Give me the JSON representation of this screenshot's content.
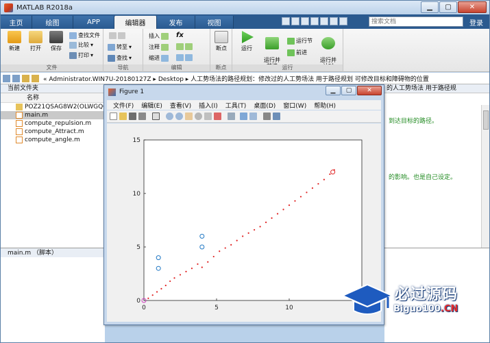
{
  "window": {
    "title": "MATLAB R2018a"
  },
  "tabs": [
    {
      "label": "主页"
    },
    {
      "label": "绘图"
    },
    {
      "label": "APP"
    },
    {
      "label": "编辑器"
    },
    {
      "label": "发布"
    },
    {
      "label": "视图"
    }
  ],
  "search": {
    "placeholder": "搜索文档"
  },
  "login_label": "登录",
  "ribbon": {
    "file_group": {
      "label": "文件",
      "new": "新建",
      "open": "打开",
      "save": "保存",
      "find_files": "查找文件",
      "compare": "比较",
      "print": "打印"
    },
    "nav_group": {
      "label": "导航",
      "goto": "转至",
      "find": "查找"
    },
    "edit_group": {
      "label": "编辑",
      "insert": "插入",
      "comment": "注释",
      "indent": "缩进",
      "fx": "fx"
    },
    "breakpoint_group": {
      "label": "断点",
      "breakpoints": "断点"
    },
    "run_group": {
      "label": "运行",
      "run": "运行",
      "run_advance": "运行并\n前进",
      "run_section": "运行节",
      "advance": "前进",
      "run_time": "运行并\n计时"
    }
  },
  "address": {
    "path": "« Administrator.WIN7U-20180127Z ▸ Desktop ▸ 人工势场法的路径规划：修改过的人工势场法 用于路径规划 可修改目标和障碍物的位置"
  },
  "file_browser": {
    "title": "当前文件夹",
    "column": "名称",
    "files": [
      {
        "name": "POZ21QSAG8W2(OLWGQC",
        "type": "folder"
      },
      {
        "name": "main.m",
        "type": "m",
        "selected": true
      },
      {
        "name": "compute_repulsion.m",
        "type": "m"
      },
      {
        "name": "compute_Attract.m",
        "type": "m"
      },
      {
        "name": "compute_angle.m",
        "type": "m"
      }
    ],
    "detail_title": "main.m  （脚本）"
  },
  "editor": {
    "tab": "的人工势场法 用于路径规",
    "lines": [
      {
        "text": "到达目标的路径。"
      },
      {
        "text": "的影响。也是自己设定。"
      }
    ]
  },
  "figure": {
    "title": "Figure 1",
    "menu": [
      "文件(F)",
      "编辑(E)",
      "查看(V)",
      "插入(I)",
      "工具(T)",
      "桌面(D)",
      "窗口(W)",
      "帮助(H)"
    ]
  },
  "chart_data": {
    "type": "scatter",
    "title": "",
    "xlabel": "",
    "ylabel": "",
    "xlim": [
      0,
      15
    ],
    "ylim": [
      0,
      15
    ],
    "xticks": [
      0,
      5,
      10
    ],
    "yticks": [
      0,
      5,
      10,
      15
    ],
    "grid": false,
    "series": [
      {
        "marker": "dot",
        "color": "#e02020",
        "x": [
          0.3,
          0.6,
          0.9,
          1.2,
          1.5,
          1.8,
          2.1,
          2.5,
          2.9,
          3.3,
          3.7,
          4.0,
          4.4,
          4.8,
          5.2,
          5.6,
          6.0,
          6.4,
          6.8,
          7.2,
          7.6,
          8.0,
          8.4,
          8.8,
          9.2,
          9.6,
          10.0,
          10.4,
          10.8,
          11.2,
          11.6,
          12.0,
          12.4,
          12.8,
          13.1
        ],
        "y": [
          0.2,
          0.5,
          0.8,
          1.1,
          1.4,
          1.8,
          2.1,
          2.4,
          2.7,
          3.0,
          3.4,
          3.1,
          3.6,
          4.1,
          4.6,
          4.9,
          5.2,
          5.6,
          6.0,
          6.3,
          6.6,
          6.9,
          7.3,
          7.7,
          8.1,
          8.5,
          8.9,
          9.3,
          9.7,
          10.1,
          10.5,
          10.9,
          11.3,
          11.8,
          12.2
        ]
      },
      {
        "marker": "circle",
        "color": "#1f77c4",
        "x": [
          1,
          1,
          4,
          4
        ],
        "y": [
          3,
          4,
          5,
          6
        ]
      },
      {
        "marker": "circle",
        "color": "#e02020",
        "x": [
          13
        ],
        "y": [
          12
        ]
      },
      {
        "marker": "circle",
        "color": "#d040c0",
        "x": [
          0
        ],
        "y": [
          0
        ]
      }
    ]
  },
  "watermark": {
    "cn": "必过源码",
    "en_a": "Biguo100",
    "en_dot": ".",
    "en_b": "CN"
  },
  "colors": {
    "tab_bar": "#2b5a8f",
    "ribbon": "#f2f2f2",
    "path_dots": "#e02020",
    "obstacles": "#1f77c4"
  }
}
